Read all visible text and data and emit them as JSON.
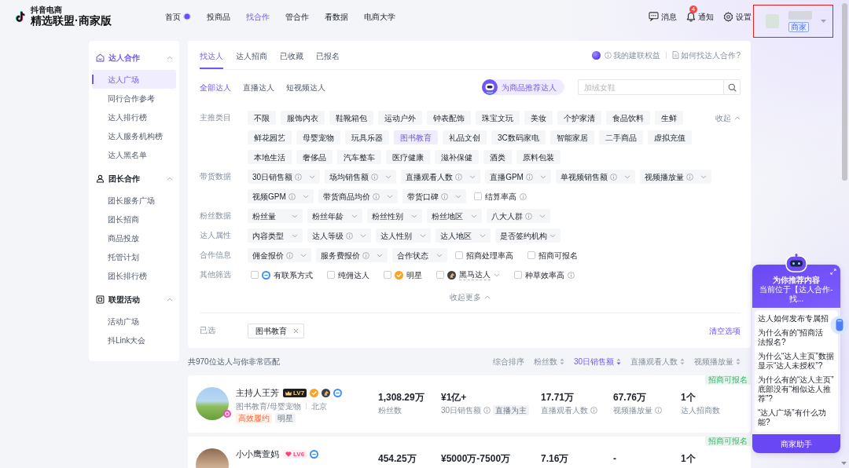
{
  "header": {
    "logo": {
      "top": "抖音电商",
      "name": "精选联盟·商家版"
    },
    "nav": [
      {
        "label": "首页",
        "selected": false,
        "dot": true
      },
      {
        "label": "投商品",
        "selected": false
      },
      {
        "label": "找合作",
        "selected": true
      },
      {
        "label": "管合作",
        "selected": false
      },
      {
        "label": "看数据",
        "selected": false
      },
      {
        "label": "电商大学",
        "selected": false
      }
    ],
    "actions": [
      {
        "kind": "message",
        "label": "消息"
      },
      {
        "kind": "bell",
        "label": "通知",
        "badge": "4"
      },
      {
        "kind": "settings",
        "label": "设置"
      }
    ],
    "user": {
      "tag": "商家",
      "highlighted": true
    }
  },
  "sidebar": {
    "sections": [
      {
        "title": "达人合作",
        "kind": "house",
        "expanded": true,
        "items": [
          {
            "label": "达人广场",
            "selected": true
          },
          {
            "label": "同行合作参考",
            "selected": false
          },
          {
            "label": "达人排行榜",
            "selected": false
          },
          {
            "label": "达人服务机构榜",
            "selected": false
          },
          {
            "label": "达人黑名单",
            "selected": false
          }
        ]
      },
      {
        "title": "团长合作",
        "kind": "person",
        "expanded": true,
        "items": [
          {
            "label": "团长服务广场",
            "selected": false
          },
          {
            "label": "团长招商",
            "selected": false
          },
          {
            "label": "商品投放",
            "selected": false
          },
          {
            "label": "托管计划",
            "selected": false
          },
          {
            "label": "团长排行榜",
            "selected": false
          }
        ]
      },
      {
        "title": "联盟活动",
        "kind": "board",
        "expanded": true,
        "items": [
          {
            "label": "活动广场",
            "selected": false
          },
          {
            "label": "抖Link大会",
            "selected": false
          }
        ]
      }
    ]
  },
  "main": {
    "tabs": [
      {
        "label": "找达人",
        "selected": true
      },
      {
        "label": "达人招商",
        "selected": false
      },
      {
        "label": "已收藏",
        "selected": false
      },
      {
        "label": "已报名",
        "selected": false
      }
    ],
    "links": [
      {
        "kind": "info",
        "text": "我的建联权益"
      },
      {
        "kind": "doc",
        "text": "如何找达人合作?"
      }
    ],
    "subtabs": [
      {
        "label": "全部达人",
        "selected": true
      },
      {
        "label": "直播达人",
        "selected": false
      },
      {
        "label": "短视频达人",
        "selected": false
      }
    ],
    "recommend_button": "为商品推荐达人",
    "search": {
      "placeholder": "加绒女鞋"
    },
    "filters": [
      {
        "label": "主推类目",
        "toggle": "收起",
        "options": [
          {
            "kind": "chip",
            "text": "不限",
            "selected": false
          },
          {
            "kind": "chip",
            "text": "服饰内衣",
            "selected": false
          },
          {
            "kind": "chip",
            "text": "鞋靴箱包",
            "selected": false
          },
          {
            "kind": "chip",
            "text": "运动户外",
            "selected": false
          },
          {
            "kind": "chip",
            "text": "钟表配饰",
            "selected": false
          },
          {
            "kind": "chip",
            "text": "珠宝文玩",
            "selected": false
          },
          {
            "kind": "chip",
            "text": "美妆",
            "selected": false
          },
          {
            "kind": "chip",
            "text": "个护家清",
            "selected": false
          },
          {
            "kind": "chip",
            "text": "食品饮料",
            "selected": false
          },
          {
            "kind": "chip",
            "text": "生鲜",
            "selected": false
          },
          {
            "kind": "chip",
            "text": "鲜花园艺",
            "selected": false
          },
          {
            "kind": "chip",
            "text": "母婴宠物",
            "selected": false
          },
          {
            "kind": "chip",
            "text": "玩具乐器",
            "selected": false
          },
          {
            "kind": "chip",
            "text": "图书教育",
            "selected": true
          },
          {
            "kind": "chip",
            "text": "礼品文创",
            "selected": false
          },
          {
            "kind": "chip",
            "text": "3C数码家电",
            "selected": false
          },
          {
            "kind": "chip",
            "text": "智能家居",
            "selected": false
          },
          {
            "kind": "chip",
            "text": "二手商品",
            "selected": false
          },
          {
            "kind": "chip",
            "text": "虚拟充值",
            "selected": false
          },
          {
            "kind": "chip",
            "text": "本地生活",
            "selected": false
          },
          {
            "kind": "chip",
            "text": "奢侈品",
            "selected": false
          },
          {
            "kind": "chip",
            "text": "汽车整车",
            "selected": false
          },
          {
            "kind": "chip",
            "text": "医疗健康",
            "selected": false
          },
          {
            "kind": "chip",
            "text": "滋补保健",
            "selected": false
          },
          {
            "kind": "chip",
            "text": "酒类",
            "selected": false
          },
          {
            "kind": "chip",
            "text": "原料包装",
            "selected": false
          }
        ]
      },
      {
        "label": "带货数据",
        "options": [
          {
            "kind": "dropdown",
            "text": "30日销售额",
            "info": true
          },
          {
            "kind": "dropdown",
            "text": "场均销售额",
            "info": true
          },
          {
            "kind": "dropdown",
            "text": "直播观看人数",
            "info": true
          },
          {
            "kind": "dropdown",
            "text": "直播GPM",
            "info": true
          },
          {
            "kind": "dropdown",
            "text": "单视频销售额",
            "info": true
          },
          {
            "kind": "dropdown",
            "text": "视频播放量",
            "info": true
          },
          {
            "kind": "dropdown",
            "text": "视频GPM",
            "info": true
          },
          {
            "kind": "dropdown",
            "text": "带货商品均价",
            "info": true
          },
          {
            "kind": "dropdown",
            "text": "带货口碑",
            "info": true
          },
          {
            "kind": "checkbox",
            "text": "结算率高",
            "info": true,
            "checked": false
          }
        ]
      },
      {
        "label": "粉丝数据",
        "options": [
          {
            "kind": "dropdown",
            "text": "粉丝量"
          },
          {
            "kind": "dropdown",
            "text": "粉丝年龄"
          },
          {
            "kind": "dropdown",
            "text": "粉丝性别"
          },
          {
            "kind": "dropdown",
            "text": "粉丝地区"
          },
          {
            "kind": "dropdown",
            "text": "八大人群",
            "info": true
          }
        ]
      },
      {
        "label": "达人属性",
        "options": [
          {
            "kind": "dropdown",
            "text": "内容类型"
          },
          {
            "kind": "dropdown",
            "text": "达人等级",
            "info": true
          },
          {
            "kind": "dropdown",
            "text": "达人性别"
          },
          {
            "kind": "dropdown",
            "text": "达人地区"
          },
          {
            "kind": "dropdown",
            "text": "是否签约机构"
          }
        ]
      },
      {
        "label": "合作信息",
        "options": [
          {
            "kind": "dropdown",
            "text": "佣金报价",
            "info": true
          },
          {
            "kind": "dropdown",
            "text": "服务费报价",
            "info": true
          },
          {
            "kind": "dropdown",
            "text": "合作状态"
          },
          {
            "kind": "checkbox",
            "text": "招商处理率高",
            "checked": false
          },
          {
            "kind": "checkbox",
            "text": "招商可报名",
            "checked": false
          }
        ]
      },
      {
        "label": "其他筛选",
        "options": [
          {
            "kind": "checkbox",
            "text": "有联系方式",
            "checked": false,
            "badge": {
              "kind": "contact"
            }
          },
          {
            "kind": "checkbox",
            "text": "纯佣达人",
            "checked": false
          },
          {
            "kind": "checkbox",
            "text": "明星",
            "checked": false,
            "badge": {
              "kind": "star"
            }
          },
          {
            "kind": "checkbox",
            "text": "黑马达人",
            "checked": false,
            "badge": {
              "kind": "darkhorse"
            },
            "dropdown": true
          },
          {
            "kind": "checkbox",
            "text": "种草效率高",
            "checked": false,
            "info": true
          }
        ]
      }
    ],
    "collapse_more": "收起更多",
    "selected_filters": {
      "label": "已选",
      "tags": [
        "图书教育"
      ],
      "clear": "清空选项"
    }
  },
  "results": {
    "summary": "共970位达人与你非常匹配",
    "sort": [
      {
        "label": "综合排序",
        "selected": false
      },
      {
        "label": "粉丝数",
        "selected": false,
        "sortable": true
      },
      {
        "label": "30日销售额",
        "selected": true,
        "sortable": true
      },
      {
        "label": "直播观看人数",
        "selected": false,
        "sortable": true
      },
      {
        "label": "视频播放量",
        "selected": false,
        "sortable": true
      }
    ],
    "creators": [
      {
        "name": "主持人王芳",
        "level": {
          "text": "LV7",
          "kind": "crown"
        },
        "badges": [
          {
            "kind": "star"
          },
          {
            "kind": "darkhorse"
          },
          {
            "kind": "contact"
          }
        ],
        "avatar_badge": true,
        "categories": "图书教育/母婴宠物",
        "location": "北京",
        "tags": [
          {
            "text": "高效履约",
            "kind": "highlight"
          },
          {
            "text": "明星",
            "kind": "plain"
          }
        ],
        "recruit_tag": "招商可报名",
        "stats": [
          {
            "value": "1,308.29万",
            "label": "粉丝数"
          },
          {
            "value": "¥1亿+",
            "label": "30日销售额",
            "info": true,
            "tag": "直播为主"
          },
          {
            "value": "17.71万",
            "label": "直播观看人数",
            "info": true
          },
          {
            "value": "67.76万",
            "label": "视频播放量",
            "info": true
          },
          {
            "value": "1个",
            "label": "达人招商数"
          }
        ]
      },
      {
        "name": "小小鹰萱妈",
        "level": {
          "text": "LV6",
          "kind": "heart"
        },
        "badges": [
          {
            "kind": "contact"
          }
        ],
        "recruit_tag": "招商可报名",
        "stats": [
          {
            "value": "454.25万"
          },
          {
            "value": "¥5000万-7500万"
          },
          {
            "value": "7.16万"
          },
          {
            "value": "-"
          },
          {
            "value": "1个"
          }
        ]
      }
    ]
  },
  "assistant": {
    "title": "为你推荐内容",
    "subtitle": "当前位于【达人合作-找...",
    "questions": [
      {
        "lines": [
          "达人如何发布专属招"
        ]
      },
      {
        "lines": [
          "为什么有的“招商活",
          "法报名?"
        ]
      },
      {
        "lines": [
          "为什么“达人主页”数据显示“达人未授权”?"
        ]
      },
      {
        "lines": [
          "为什么有的“达人主页”底部没有“相似达人推荐”?"
        ]
      },
      {
        "lines": [
          "“达人广场”有什么功能?"
        ]
      }
    ],
    "button": "商家助手"
  }
}
